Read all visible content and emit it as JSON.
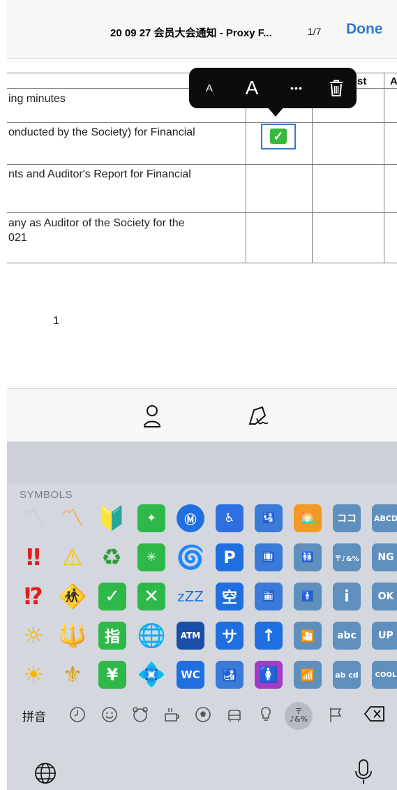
{
  "navbar": {
    "title": "20 09 27 会员大会通知 - Proxy F...",
    "page_indicator": "1/7",
    "done_label": "Done"
  },
  "document": {
    "column_headers": [
      "st",
      "A"
    ],
    "rows": [
      {
        "lines": [
          "ing minutes"
        ],
        "checked": false
      },
      {
        "lines": [
          "onducted by the Society) for Financial"
        ],
        "checked": true
      },
      {
        "lines": [
          "nts and Auditor's Report for Financial"
        ],
        "checked": false
      },
      {
        "lines": [
          "any as Auditor of the Society for the",
          "021"
        ],
        "checked": false
      }
    ],
    "page_number": "1"
  },
  "popup_toolbar": {
    "small_font_label": "A",
    "large_font_label": "A",
    "more_label": "•••",
    "delete_icon": "trash-icon"
  },
  "accessory_bar": {
    "icons": [
      "person-icon",
      "signature-icon"
    ]
  },
  "keyboard": {
    "category_label": "SYMBOLS",
    "input_mode_label": "拼音",
    "emoji_rows": [
      [
        "〽",
        "〽",
        "🔰",
        "✦",
        "Ⓜ",
        "♿",
        "🛂",
        "🌅",
        "ココ",
        "ABCD"
      ],
      [
        "‼",
        "⚠",
        "♻",
        "✳",
        "🌀",
        "P",
        "🛄",
        "🚻",
        "〒♪&%",
        "NG"
      ],
      [
        "⁉",
        "🚸",
        "✓",
        "✕",
        "zZZ",
        "空",
        "🛅",
        "🚹",
        "i",
        "OK"
      ],
      [
        "☼",
        "🔱",
        "指",
        "🌐",
        "ATM",
        "サ",
        "↑",
        "🎦",
        "abc",
        "UP"
      ],
      [
        "☀",
        "⚜",
        "¥",
        "💠",
        "WC",
        "🛃",
        "🚺",
        "📶",
        "ab cd",
        "COOL"
      ]
    ],
    "category_icons": [
      "clock-icon",
      "smiley-icon",
      "bear-icon",
      "cup-icon",
      "ball-icon",
      "car-icon",
      "bulb-icon",
      "symbols-icon",
      "flag-icon"
    ],
    "active_category": "symbols-icon",
    "symbols_tab_label": "〒♪&%",
    "footer_icons": [
      "globe-icon",
      "microphone-icon"
    ]
  }
}
